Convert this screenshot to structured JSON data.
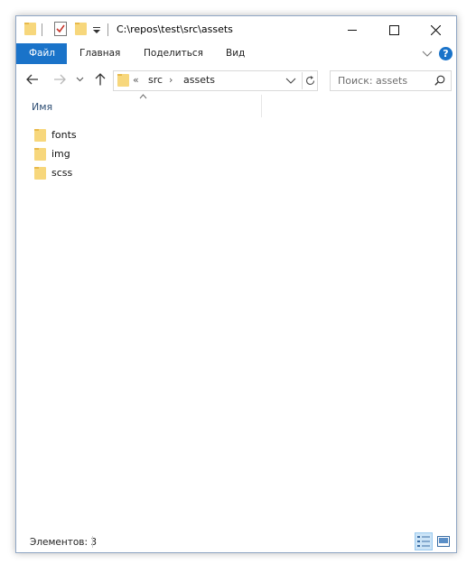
{
  "titlebar": {
    "title": "C:\\repos\\test\\src\\assets",
    "quick_access": [
      "folder-icon",
      "properties-check-icon",
      "new-folder-icon",
      "customize-dropdown-icon"
    ],
    "controls": [
      "minimize-icon",
      "maximize-icon",
      "close-icon"
    ]
  },
  "ribbon": {
    "file_tab": "Файл",
    "tabs": [
      "Главная",
      "Поделиться",
      "Вид"
    ],
    "file_tab_color": "#1a73c9",
    "help_label": "?"
  },
  "nav": {
    "overflow": "«",
    "crumbs": [
      "src",
      "assets"
    ],
    "arrows": [
      "›",
      "›"
    ]
  },
  "search": {
    "placeholder": "Поиск: assets"
  },
  "content": {
    "column_name": "Имя",
    "items": [
      {
        "name": "fonts",
        "icon": "folder-icon"
      },
      {
        "name": "img",
        "icon": "folder-icon"
      },
      {
        "name": "scss",
        "icon": "folder-icon"
      }
    ]
  },
  "status": {
    "text": "Элементов: 3",
    "views": [
      "details-view-icon",
      "large-icons-view-icon"
    ]
  },
  "colors": {
    "folder_fill": "#f7d77c",
    "folder_tab": "#e8b94a",
    "accent": "#1a73c9"
  }
}
